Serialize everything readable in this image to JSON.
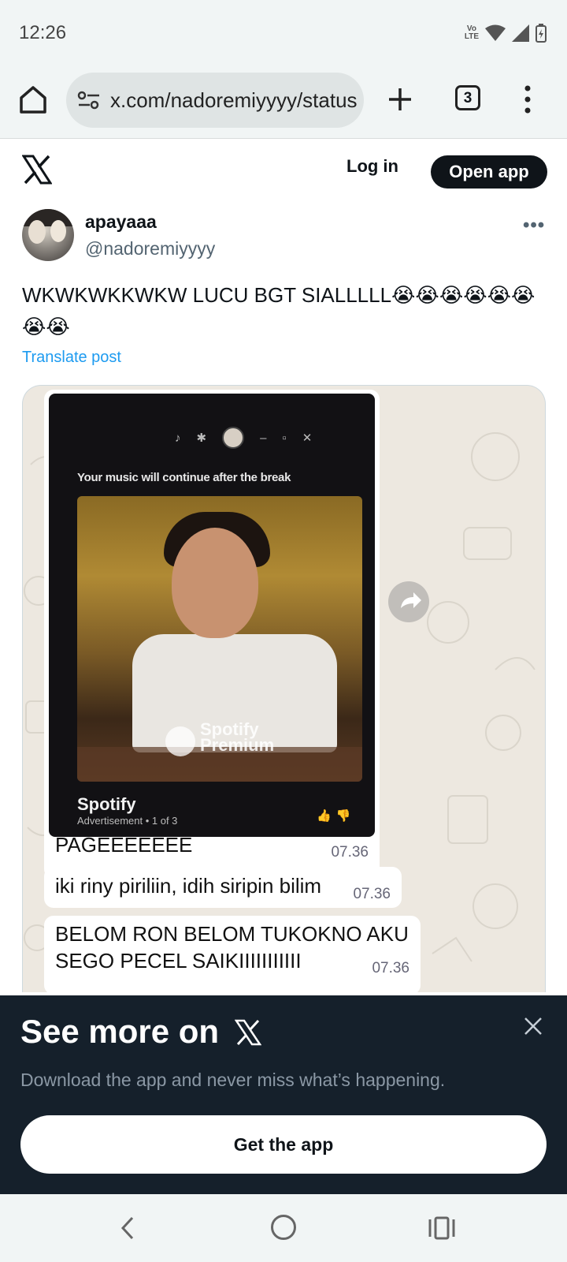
{
  "status_bar": {
    "time": "12:26",
    "network": "Vo LTE"
  },
  "browser": {
    "url": "x.com/nadoremiyyyy/status",
    "tab_count": "3"
  },
  "x_header": {
    "login_label": "Log in",
    "open_app_label": "Open app"
  },
  "post": {
    "display_name": "apayaaa",
    "handle": "@nadoremiyyyy",
    "more_label": "•••",
    "text": "WKWKWKKWKW LUCU BGT SIALLLLL😭😭😭😭😭😭😭😭",
    "translate_label": "Translate post"
  },
  "media": {
    "spotify": {
      "banner": "Your music will continue after the break",
      "premium_label": "Spotify Premium",
      "brand": "Spotify",
      "ad_label": "Advertisement • 1 of 3"
    },
    "messages": [
      {
        "text": "PAGEEEEEEE",
        "time": "07.36"
      },
      {
        "text": "iki riny piriliin, idih siripin bilim",
        "time": "07.36"
      },
      {
        "text_line1": "BELOM RON BELOM TUKOKNO AKU",
        "text_line2": "SEGO PECEL SAIKIIIIIIIIIII",
        "time": "07.36"
      }
    ]
  },
  "sheet": {
    "title": "See more on",
    "subtitle": "Download the app and never miss what’s happening.",
    "button_label": "Get the app"
  },
  "colors": {
    "x_blue": "#1d9bf0",
    "sheet_bg": "#15202b",
    "chrome_bg": "#f1f5f5"
  }
}
